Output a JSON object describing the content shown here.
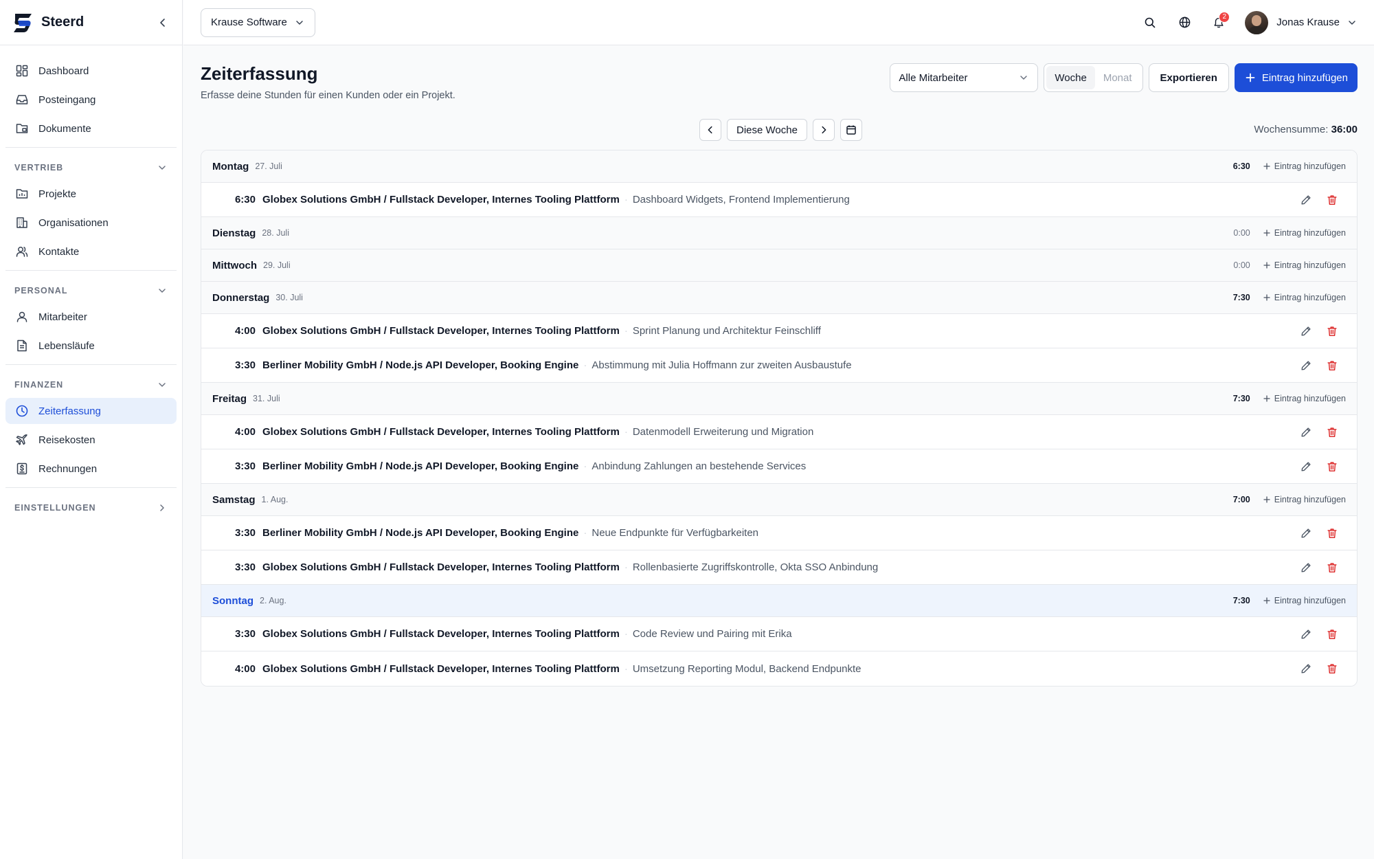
{
  "brand": {
    "name": "Steerd"
  },
  "colors": {
    "accent": "#1d4ed8",
    "danger": "#dc2626",
    "badge": "#ef4444"
  },
  "sidebar": {
    "top_items": [
      {
        "label": "Dashboard",
        "icon": "dashboard-icon"
      },
      {
        "label": "Posteingang",
        "icon": "inbox-icon"
      },
      {
        "label": "Dokumente",
        "icon": "documents-icon"
      }
    ],
    "sections": [
      {
        "title": "VERTRIEB",
        "items": [
          {
            "label": "Projekte",
            "icon": "projects-icon"
          },
          {
            "label": "Organisationen",
            "icon": "organizations-icon"
          },
          {
            "label": "Kontakte",
            "icon": "contacts-icon"
          }
        ]
      },
      {
        "title": "PERSONAL",
        "items": [
          {
            "label": "Mitarbeiter",
            "icon": "employee-icon"
          },
          {
            "label": "Lebensläufe",
            "icon": "resume-icon"
          }
        ]
      },
      {
        "title": "FINANZEN",
        "items": [
          {
            "label": "Zeiterfassung",
            "icon": "clock-icon",
            "active": true
          },
          {
            "label": "Reisekosten",
            "icon": "plane-icon"
          },
          {
            "label": "Rechnungen",
            "icon": "invoice-icon"
          }
        ]
      }
    ],
    "settings": "EINSTELLUNGEN"
  },
  "topbar": {
    "company": "Krause Software",
    "notification_count": "2",
    "user_name": "Jonas Krause"
  },
  "page": {
    "title": "Zeiterfassung",
    "subtitle": "Erfasse deine Stunden für einen Kunden oder ein Projekt.",
    "employee_filter": "Alle Mitarbeiter",
    "view_week": "Woche",
    "view_month": "Monat",
    "export_label": "Exportieren",
    "add_label": "Eintrag hinzufügen",
    "this_week": "Diese Woche",
    "week_sum_label": "Wochensumme:",
    "week_sum_value": "36:00",
    "day_add_label": "Eintrag hinzufügen"
  },
  "days": [
    {
      "name": "Montag",
      "date": "27. Juli",
      "total": "6:30",
      "entries": [
        {
          "time": "6:30",
          "project": "Globex Solutions GmbH / Fullstack Developer, Internes Tooling Plattform",
          "desc": "Dashboard Widgets, Frontend Implementierung"
        }
      ]
    },
    {
      "name": "Dienstag",
      "date": "28. Juli",
      "total": "0:00",
      "entries": []
    },
    {
      "name": "Mittwoch",
      "date": "29. Juli",
      "total": "0:00",
      "entries": []
    },
    {
      "name": "Donnerstag",
      "date": "30. Juli",
      "total": "7:30",
      "entries": [
        {
          "time": "4:00",
          "project": "Globex Solutions GmbH / Fullstack Developer, Internes Tooling Plattform",
          "desc": "Sprint Planung und Architektur Feinschliff"
        },
        {
          "time": "3:30",
          "project": "Berliner Mobility GmbH / Node.js API Developer, Booking Engine",
          "desc": "Abstimmung mit Julia Hoffmann zur zweiten Ausbaustufe"
        }
      ]
    },
    {
      "name": "Freitag",
      "date": "31. Juli",
      "total": "7:30",
      "entries": [
        {
          "time": "4:00",
          "project": "Globex Solutions GmbH / Fullstack Developer, Internes Tooling Plattform",
          "desc": "Datenmodell Erweiterung und Migration"
        },
        {
          "time": "3:30",
          "project": "Berliner Mobility GmbH / Node.js API Developer, Booking Engine",
          "desc": "Anbindung Zahlungen an bestehende Services"
        }
      ]
    },
    {
      "name": "Samstag",
      "date": "1. Aug.",
      "total": "7:00",
      "entries": [
        {
          "time": "3:30",
          "project": "Berliner Mobility GmbH / Node.js API Developer, Booking Engine",
          "desc": "Neue Endpunkte für Verfügbarkeiten"
        },
        {
          "time": "3:30",
          "project": "Globex Solutions GmbH / Fullstack Developer, Internes Tooling Plattform",
          "desc": "Rollenbasierte Zugriffskontrolle, Okta SSO Anbindung"
        }
      ]
    },
    {
      "name": "Sonntag",
      "date": "2. Aug.",
      "total": "7:30",
      "today": true,
      "entries": [
        {
          "time": "3:30",
          "project": "Globex Solutions GmbH / Fullstack Developer, Internes Tooling Plattform",
          "desc": "Code Review und Pairing mit Erika"
        },
        {
          "time": "4:00",
          "project": "Globex Solutions GmbH / Fullstack Developer, Internes Tooling Plattform",
          "desc": "Umsetzung Reporting Modul, Backend Endpunkte"
        }
      ]
    }
  ]
}
